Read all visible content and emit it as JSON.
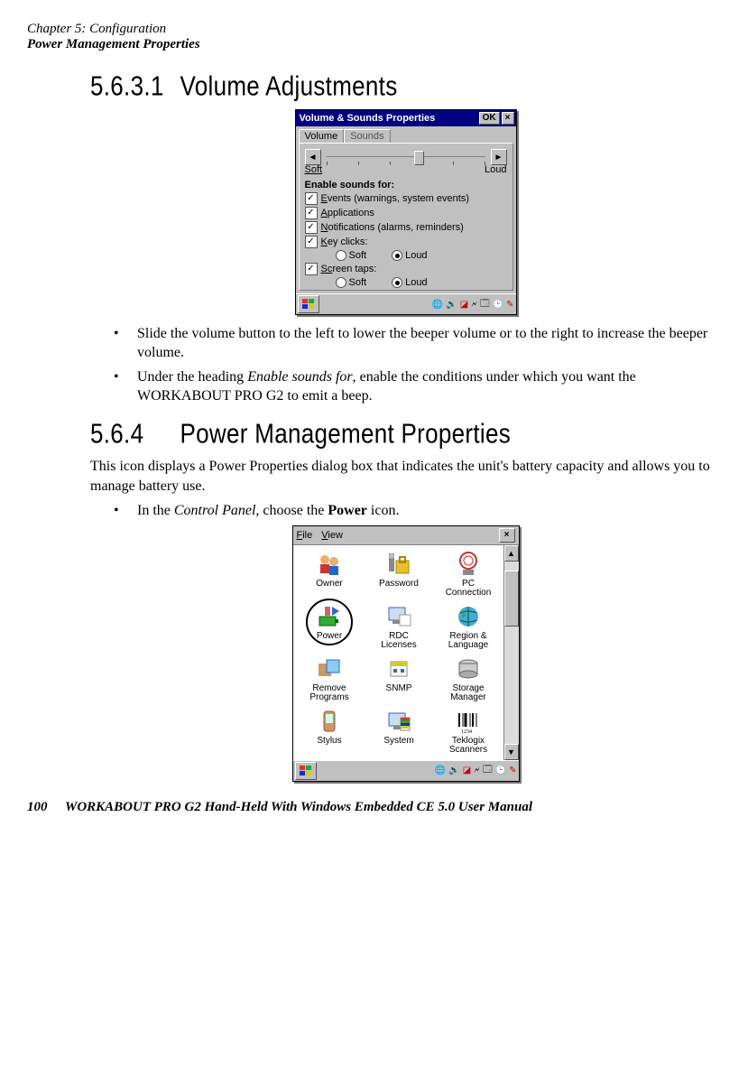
{
  "header": {
    "chapter": "Chapter 5: Configuration",
    "section": "Power Management Properties"
  },
  "s1": {
    "number": "5.6.3.1",
    "title": "Volume Adjustments"
  },
  "vsound": {
    "title": "Volume & Sounds Properties",
    "ok": "OK",
    "close": "×",
    "tab_volume": "Volume",
    "tab_sounds": "Sounds",
    "soft": "Soft",
    "loud": "Loud",
    "enable_heading": "Enable sounds for:",
    "events": "vents (warnings, system events)",
    "events_u": "E",
    "applications": "pplications",
    "applications_u": "A",
    "notifications": "otifications (alarms, reminders)",
    "notifications_u": "N",
    "keyclicks": "ey clicks:",
    "keyclicks_u": "K",
    "screentaps": "reen taps:",
    "screentaps_u": "Sc",
    "r_soft": "Soft",
    "r_loud": "Loud"
  },
  "bullets1": {
    "b1": "Slide the volume button to the left to lower the beeper volume or to the right to increase the beeper volume.",
    "b2a": "Under the heading ",
    "b2i": "Enable sounds for",
    "b2b": ", enable the conditions under which you want the WORKABOUT PRO G2 to emit a beep."
  },
  "s2": {
    "number": "5.6.4",
    "title": "Power Management Properties"
  },
  "p1": "This icon displays a Power Properties dialog box that indicates the unit's battery capacity and allows you to manage battery use.",
  "bullets2": {
    "b1a": "In the ",
    "b1i": "Control Panel",
    "b1b": ", choose the ",
    "b1s": "Power",
    "b1c": " icon."
  },
  "cp": {
    "menu_file": "File",
    "menu_view": "View",
    "close": "×",
    "items": {
      "owner": "Owner",
      "password": "Password",
      "pcconn": "PC\nConnection",
      "power": "Power",
      "rdc": "RDC\nLicenses",
      "region": "Region &\nLanguage",
      "remove": "Remove\nPrograms",
      "snmp": "SNMP",
      "storage": "Storage\nManager",
      "stylus": "Stylus",
      "system": "System",
      "teklogix": "Teklogix\nScanners"
    }
  },
  "footer": {
    "page": "100",
    "text": "WORKABOUT PRO G2 Hand-Held With Windows Embedded CE 5.0 User Manual"
  }
}
